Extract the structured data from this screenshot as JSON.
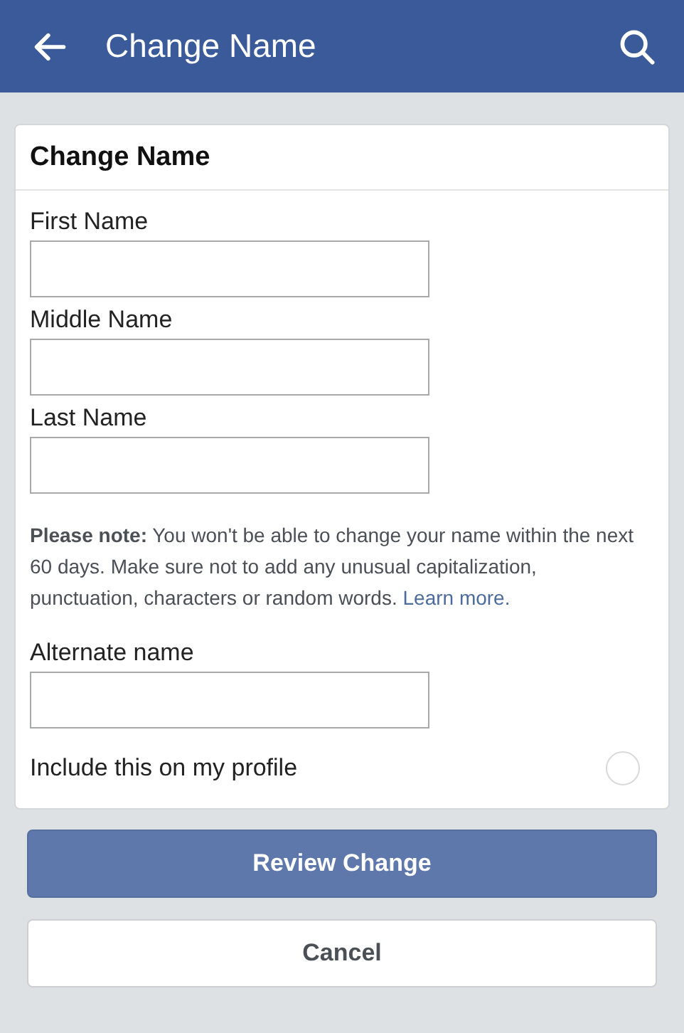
{
  "header": {
    "title": "Change Name"
  },
  "card": {
    "title": "Change Name",
    "fields": [
      {
        "label": "First Name"
      },
      {
        "label": "Middle Name"
      },
      {
        "label": "Last Name"
      }
    ],
    "note": {
      "text": "**Please note:** You won't be able to change your name within the next 60 days. Make sure not to add any unusual capitalization, punctuation, characters or random words.",
      "link": "Learn more."
    },
    "alternate": {
      "label": "Alternate name"
    },
    "include": {
      "label": "Include this on my profile",
      "checked": false
    }
  },
  "buttons": [
    {
      "label": "Review Change",
      "kind": "primary"
    },
    {
      "label": "Cancel",
      "kind": "secondary"
    }
  ]
}
